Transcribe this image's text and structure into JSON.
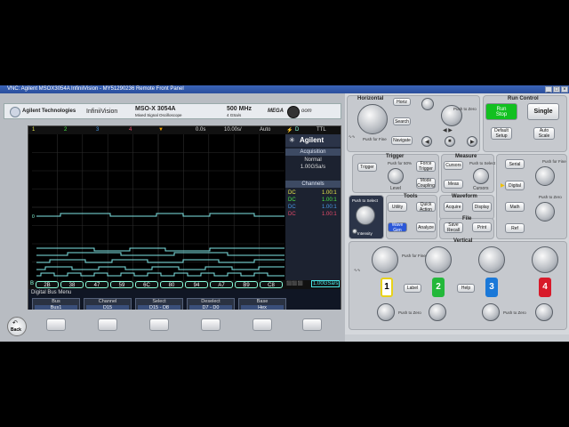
{
  "window": {
    "title": "VNC: Agilent MSOX3054A InfiniiVision - MY51290236 Remote Front Panel"
  },
  "header": {
    "brand": "Agilent Technologies",
    "series": "InfiniiVision",
    "model": "MSO-X 3054A",
    "model_sub": "Mixed Signal Oscilloscope",
    "bandwidth": "500 MHz",
    "sample_rate": "4 GSa/s",
    "megazoom": "MEGA",
    "megazoom2": "oom"
  },
  "screen": {
    "topbar": {
      "ch1": "1",
      "ch2": "2",
      "ch3": "3",
      "ch4": "4",
      "delay": "0.0s",
      "timebase": "10.00s/",
      "mode": "Auto",
      "trig_src": "D",
      "trig_type": "TTL"
    },
    "side": {
      "agilent": "Agilent",
      "acq_title": "Acquisition",
      "acq_mode": "Normal",
      "acq_rate": "1.00GSa/s",
      "channels_title": "Channels",
      "channels": [
        {
          "coupling": "DC",
          "value": "1.00:1",
          "color": "#e8e84a"
        },
        {
          "coupling": "DC",
          "value": "1.00:1",
          "color": "#4ae84a"
        },
        {
          "coupling": "DC",
          "value": "1.00:1",
          "color": "#4a9ae8"
        },
        {
          "coupling": "DC",
          "value": "1.00:1",
          "color": "#e84a6a"
        }
      ]
    },
    "bus_values": [
      "2B",
      "38",
      "47",
      "59",
      "6C",
      "80",
      "94",
      "A7",
      "B9",
      "C8"
    ],
    "bus_label": "B",
    "status_right": "1.00GSa/s",
    "softkeys": {
      "menu_title": "Digital Bus Menu",
      "keys": [
        {
          "top": "Bus",
          "value": "Bus1"
        },
        {
          "top": "Channel",
          "value": "D15"
        },
        {
          "top": "Select",
          "value": "D15 - D8"
        },
        {
          "top": "Deselect",
          "value": "D7 - D0"
        },
        {
          "top": "Base",
          "value": "Hex"
        }
      ]
    }
  },
  "bottom": {
    "back_label": "Back"
  },
  "panel": {
    "horizontal": {
      "title": "Horizontal",
      "menu": "Horiz",
      "search": "Search",
      "navigate": "Navigate",
      "push_fine": "Push for Fine",
      "push_zero": "Push to Zero"
    },
    "run_control": {
      "title": "Run Control",
      "run_stop": "Run\nStop",
      "single": "Single",
      "default_setup": "Default\nSetup",
      "auto_scale": "Auto\nScale"
    },
    "trigger": {
      "title": "Trigger",
      "trigger_btn": "Trigger",
      "force": "Force\nTrigger",
      "level": "Level",
      "push_50": "Push for 50%"
    },
    "measure": {
      "title": "Measure",
      "cursors_btn": "Cursors",
      "meas": "Meas",
      "cursors_knob": "Cursors",
      "push_select": "Push to Select"
    },
    "tools": {
      "title": "Tools",
      "utility": "Utility",
      "quick_action": "Quick\nAction",
      "analyze": "Analyze",
      "mode_coupling": "Mode\nCoupling",
      "wave_gen": "Wave\nGen",
      "intensity": "Intensity",
      "push_select": "Push to Select"
    },
    "waveform": {
      "title": "Waveform",
      "acquire": "Acquire",
      "display": "Display"
    },
    "file": {
      "title": "File",
      "save_recall": "Save\nRecall",
      "print": "Print"
    },
    "serial": {
      "serial": "Serial",
      "digital": "Digital",
      "math": "Math",
      "ref": "Ref",
      "push_fine": "Push for Fine",
      "push_zero": "Push to Zero"
    },
    "vertical": {
      "title": "Vertical",
      "label": "Label",
      "help": "Help",
      "push_fine": "Push for Fine",
      "push_zero": "Push to Zero",
      "ch": [
        "1",
        "2",
        "3",
        "4"
      ]
    }
  },
  "colors": {
    "ch1": "#e8d21a",
    "ch2": "#23b83a",
    "ch3": "#1a78d8",
    "ch4": "#d81a2a",
    "run": "#12c020"
  }
}
